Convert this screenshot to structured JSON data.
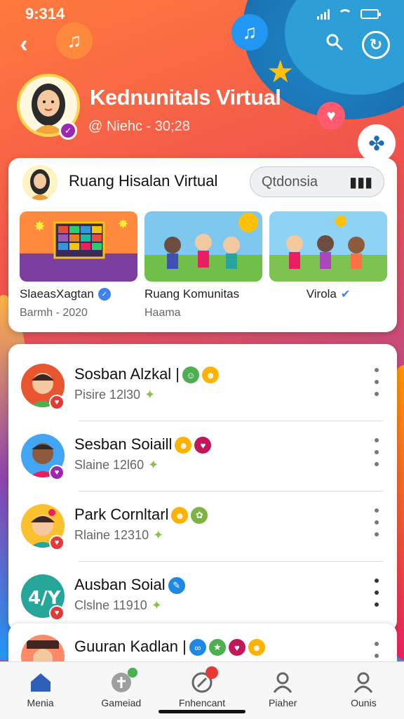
{
  "status_bar": {
    "time": "9:314"
  },
  "profile": {
    "name": "Kednunitals Virtual",
    "handle": "@ Niehc - 30;28"
  },
  "community_card": {
    "title": "Ruang Hisalan Virtual",
    "search_value": "Qtdonsia",
    "tiles": [
      {
        "label": "SlaeasXagtan",
        "sub": "Barmh - 2020",
        "verified": true
      },
      {
        "label": "Ruang Komunitas",
        "sub": "Haama",
        "verified": false
      },
      {
        "label": "Virola",
        "sub": "",
        "verified": true
      }
    ]
  },
  "list": [
    {
      "name": "Sosban Alzkal |",
      "sub": "Pisire 12l30",
      "avatar_color": "#e8552f",
      "badge_color": "#e53935",
      "emojis": [
        {
          "icon": "smile-icon",
          "color": "#4caf50",
          "glyph": "☺"
        },
        {
          "icon": "grin-icon",
          "color": "#ffb300",
          "glyph": "☻"
        }
      ]
    },
    {
      "name": "Sesban Soiaill",
      "sub": "Slaine 12l60",
      "avatar_color": "#42a5f5",
      "badge_color": "#9c27b0",
      "emojis": [
        {
          "icon": "grin-icon",
          "color": "#ffb300",
          "glyph": "☻"
        },
        {
          "icon": "heart-icon",
          "color": "#c2185b",
          "glyph": "♥"
        }
      ]
    },
    {
      "name": "Park Cornltarl",
      "sub": "Rlaine 12310",
      "avatar_color": "#fbc02d",
      "badge_color": "#e53935",
      "emojis": [
        {
          "icon": "grin-icon",
          "color": "#ffb300",
          "glyph": "☻"
        },
        {
          "icon": "leaf-icon",
          "color": "#7cb342",
          "glyph": "✿"
        }
      ]
    },
    {
      "name": "Ausban Soial",
      "sub": "Clslne 11910",
      "avatar_color": "#26a69a",
      "badge_color": "#e53935",
      "emojis": [
        {
          "icon": "chat-icon",
          "color": "#1e88e5",
          "glyph": "✎"
        }
      ]
    }
  ],
  "partial_row": {
    "name": "Guuran Kadlan |"
  },
  "bottom_nav": [
    {
      "label": "Menia",
      "icon": "home-icon",
      "active": true
    },
    {
      "label": "Gameiad",
      "icon": "gamepad-icon",
      "active": false
    },
    {
      "label": "Fnhencant",
      "icon": "compass-icon",
      "active": false
    },
    {
      "label": "Piaher",
      "icon": "person-icon",
      "active": false
    },
    {
      "label": "Ounis",
      "icon": "profile-icon",
      "active": false
    }
  ],
  "colors": {
    "accent": "#2e5fb8",
    "header_gradient_start": "#ff7a3d",
    "header_gradient_end": "#3d8fdc"
  }
}
